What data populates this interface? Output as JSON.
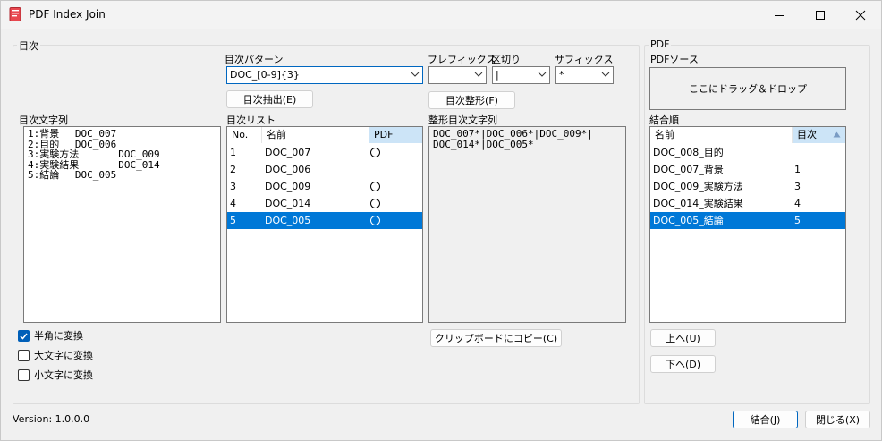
{
  "window": {
    "title": "PDF Index Join"
  },
  "toc_group": {
    "label": "目次",
    "pattern": {
      "label": "目次パターン",
      "value": "DOC_[0-9]{3}"
    },
    "prefix": {
      "label": "プレフィックス",
      "value": ""
    },
    "separator": {
      "label": "区切り",
      "value": "|"
    },
    "suffix": {
      "label": "サフィックス",
      "value": "*"
    },
    "extract_button": "目次抽出(E)",
    "format_button": "目次整形(F)",
    "toc_text": {
      "label": "目次文字列",
      "lines": [
        "1:背景　 DOC_007",
        "2:目的　 DOC_006",
        "3:実験方法　　　　DOC_009",
        "4:実験結果　　　　DOC_014",
        "5:結論　 DOC_005"
      ]
    },
    "toc_list": {
      "label": "目次リスト",
      "headers": [
        "No.",
        "名前",
        "PDF"
      ],
      "rows": [
        {
          "no": "1",
          "name": "DOC_007",
          "pdf": true
        },
        {
          "no": "2",
          "name": "DOC_006",
          "pdf": false
        },
        {
          "no": "3",
          "name": "DOC_009",
          "pdf": true
        },
        {
          "no": "4",
          "name": "DOC_014",
          "pdf": true
        },
        {
          "no": "5",
          "name": "DOC_005",
          "pdf": true
        }
      ],
      "selected_index": 4
    },
    "formatted": {
      "label": "整形目次文字列",
      "lines": [
        "DOC_007*|DOC_006*|DOC_009*|",
        "DOC_014*|DOC_005*"
      ]
    },
    "copy_button": "クリップボードにコピー(C)",
    "checkboxes": [
      {
        "label": "半角に変換",
        "checked": true
      },
      {
        "label": "大文字に変換",
        "checked": false
      },
      {
        "label": "小文字に変換",
        "checked": false
      }
    ]
  },
  "pdf_group": {
    "label": "PDF",
    "source_label": "PDFソース",
    "drop_text": "ここにドラッグ＆ドロップ",
    "order_label": "結合順",
    "headers": [
      "名前",
      "目次"
    ],
    "rows": [
      {
        "name": "DOC_008_目的",
        "toc": ""
      },
      {
        "name": "DOC_007_背景",
        "toc": "1"
      },
      {
        "name": "DOC_009_実験方法",
        "toc": "3"
      },
      {
        "name": "DOC_014_実験結果",
        "toc": "4"
      },
      {
        "name": "DOC_005_結論",
        "toc": "5"
      }
    ],
    "selected_index": 4,
    "up_button": "上へ(U)",
    "down_button": "下へ(D)"
  },
  "footer": {
    "version": "Version: 1.0.0.0",
    "join_button": "結合(J)",
    "close_button": "閉じる(X)"
  },
  "colors": {
    "selection": "#0078d7",
    "column_header_active": "#cce4f7",
    "focus_border": "#0067c0"
  }
}
